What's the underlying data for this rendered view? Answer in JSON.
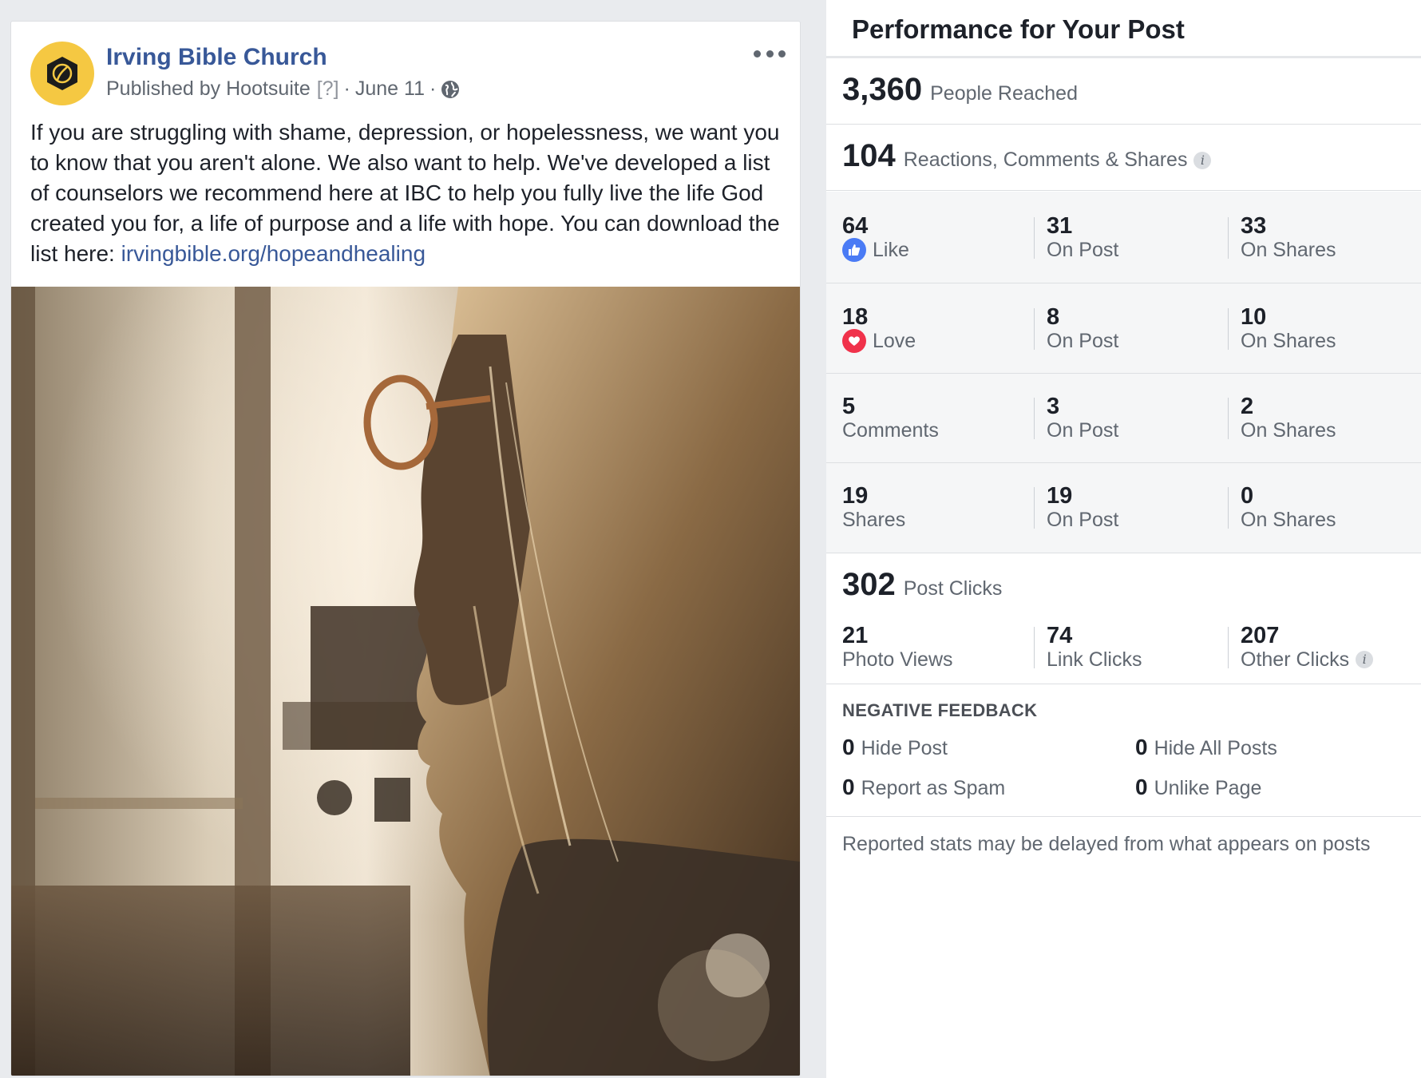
{
  "post": {
    "page_name": "Irving Bible Church",
    "published_by_prefix": "Published by",
    "app_name": "Hootsuite",
    "help_marker": "[?]",
    "separator": "·",
    "date": "June 11",
    "body_text": "If you are struggling with shame, depression, or hopelessness, we want you to know that you aren't alone. We also want to help. We've developed a list of counselors we recommend here at IBC to help you fully live the life God created you for, a life of purpose and a life with hope. You can download the list here: ",
    "link_text": "irvingbible.org/hopeandhealing",
    "options_icon": "more-horizontal-icon",
    "audience_icon": "globe-icon"
  },
  "panel": {
    "title": "Performance for Your Post",
    "reach": {
      "value": "3,360",
      "label": "People Reached"
    },
    "engagement": {
      "value": "104",
      "label": "Reactions, Comments & Shares"
    },
    "rows": [
      {
        "total": "64",
        "label": "Like",
        "icon": "like-icon",
        "on_post": "31",
        "on_post_label": "On Post",
        "on_shares": "33",
        "on_shares_label": "On Shares"
      },
      {
        "total": "18",
        "label": "Love",
        "icon": "love-icon",
        "on_post": "8",
        "on_post_label": "On Post",
        "on_shares": "10",
        "on_shares_label": "On Shares"
      },
      {
        "total": "5",
        "label": "Comments",
        "on_post": "3",
        "on_post_label": "On Post",
        "on_shares": "2",
        "on_shares_label": "On Shares"
      },
      {
        "total": "19",
        "label": "Shares",
        "on_post": "19",
        "on_post_label": "On Post",
        "on_shares": "0",
        "on_shares_label": "On Shares"
      }
    ],
    "clicks": {
      "value": "302",
      "label": "Post Clicks",
      "items": [
        {
          "value": "21",
          "label": "Photo Views"
        },
        {
          "value": "74",
          "label": "Link Clicks"
        },
        {
          "value": "207",
          "label": "Other Clicks"
        }
      ]
    },
    "negative": {
      "heading": "NEGATIVE FEEDBACK",
      "items": [
        {
          "value": "0",
          "label": "Hide Post"
        },
        {
          "value": "0",
          "label": "Hide All Posts"
        },
        {
          "value": "0",
          "label": "Report as Spam"
        },
        {
          "value": "0",
          "label": "Unlike Page"
        }
      ]
    },
    "footnote": "Reported stats may be delayed from what appears on posts"
  },
  "colors": {
    "link": "#385898",
    "like": "#4a7bf5",
    "love": "#f0324b",
    "avatar": "#f5c842"
  }
}
